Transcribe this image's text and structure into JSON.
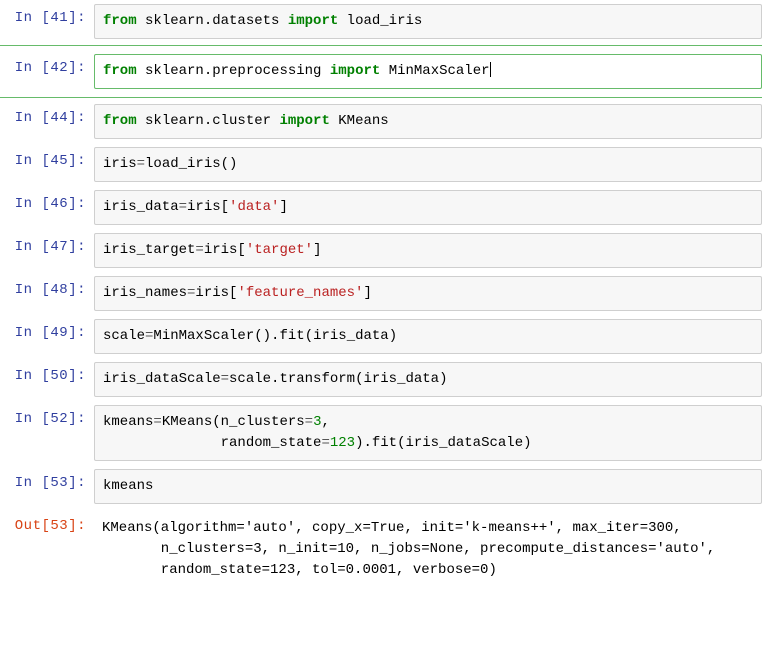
{
  "cells": [
    {
      "kind": "in",
      "num": "41",
      "prompt": "In  [41]:",
      "tokens": [
        {
          "t": "from",
          "c": "kw-green"
        },
        {
          "t": " "
        },
        {
          "t": "sklearn.datasets"
        },
        {
          "t": " "
        },
        {
          "t": "import",
          "c": "kw-green"
        },
        {
          "t": " "
        },
        {
          "t": "load_iris"
        }
      ]
    },
    {
      "kind": "in",
      "num": "42",
      "prompt": "In  [42]:",
      "selected": true,
      "cursor_end": true,
      "tokens": [
        {
          "t": "from",
          "c": "kw-green"
        },
        {
          "t": " "
        },
        {
          "t": "sklearn.preprocessing"
        },
        {
          "t": " "
        },
        {
          "t": "import",
          "c": "kw-green"
        },
        {
          "t": " "
        },
        {
          "t": "MinMaxScaler"
        }
      ]
    },
    {
      "kind": "in",
      "num": "44",
      "prompt": "In  [44]:",
      "tokens": [
        {
          "t": "from",
          "c": "kw-green"
        },
        {
          "t": " "
        },
        {
          "t": "sklearn.cluster"
        },
        {
          "t": " "
        },
        {
          "t": "import",
          "c": "kw-green"
        },
        {
          "t": " "
        },
        {
          "t": "KMeans"
        }
      ]
    },
    {
      "kind": "in",
      "num": "45",
      "prompt": "In  [45]:",
      "tokens": [
        {
          "t": "iris"
        },
        {
          "t": "=",
          "c": "op"
        },
        {
          "t": "load_iris"
        },
        {
          "t": "()"
        }
      ]
    },
    {
      "kind": "in",
      "num": "46",
      "prompt": "In  [46]:",
      "tokens": [
        {
          "t": "iris_data"
        },
        {
          "t": "=",
          "c": "op"
        },
        {
          "t": "iris["
        },
        {
          "t": "'data'",
          "c": "str-red"
        },
        {
          "t": "]"
        }
      ]
    },
    {
      "kind": "in",
      "num": "47",
      "prompt": "In  [47]:",
      "tokens": [
        {
          "t": "iris_target"
        },
        {
          "t": "=",
          "c": "op"
        },
        {
          "t": "iris["
        },
        {
          "t": "'target'",
          "c": "str-red"
        },
        {
          "t": "]"
        }
      ]
    },
    {
      "kind": "in",
      "num": "48",
      "prompt": "In  [48]:",
      "tokens": [
        {
          "t": "iris_names"
        },
        {
          "t": "=",
          "c": "op"
        },
        {
          "t": "iris["
        },
        {
          "t": "'feature_names'",
          "c": "str-red"
        },
        {
          "t": "]"
        }
      ]
    },
    {
      "kind": "in",
      "num": "49",
      "prompt": "In  [49]:",
      "tokens": [
        {
          "t": "scale"
        },
        {
          "t": "=",
          "c": "op"
        },
        {
          "t": "MinMaxScaler"
        },
        {
          "t": "()."
        },
        {
          "t": "fit"
        },
        {
          "t": "(iris_data)"
        }
      ]
    },
    {
      "kind": "in",
      "num": "50",
      "prompt": "In  [50]:",
      "tokens": [
        {
          "t": "iris_dataScale"
        },
        {
          "t": "=",
          "c": "op"
        },
        {
          "t": "scale.transform"
        },
        {
          "t": "(iris_data)"
        }
      ]
    },
    {
      "kind": "in",
      "num": "52",
      "prompt": "In  [52]:",
      "tokens": [
        {
          "t": "kmeans"
        },
        {
          "t": "=",
          "c": "op"
        },
        {
          "t": "KMeans"
        },
        {
          "t": "(n_clusters"
        },
        {
          "t": "=",
          "c": "op"
        },
        {
          "t": "3",
          "c": "num"
        },
        {
          "t": ",\n"
        },
        {
          "t": "              random_state"
        },
        {
          "t": "=",
          "c": "op"
        },
        {
          "t": "123",
          "c": "num"
        },
        {
          "t": ").fit(iris_dataScale)"
        }
      ]
    },
    {
      "kind": "in",
      "num": "53",
      "prompt": "In  [53]:",
      "tokens": [
        {
          "t": "kmeans"
        }
      ]
    },
    {
      "kind": "out",
      "num": "53",
      "prompt": "Out[53]:",
      "text": "KMeans(algorithm='auto', copy_x=True, init='k-means++', max_iter=300,\n       n_clusters=3, n_init=10, n_jobs=None, precompute_distances='auto',\n       random_state=123, tol=0.0001, verbose=0)"
    }
  ]
}
